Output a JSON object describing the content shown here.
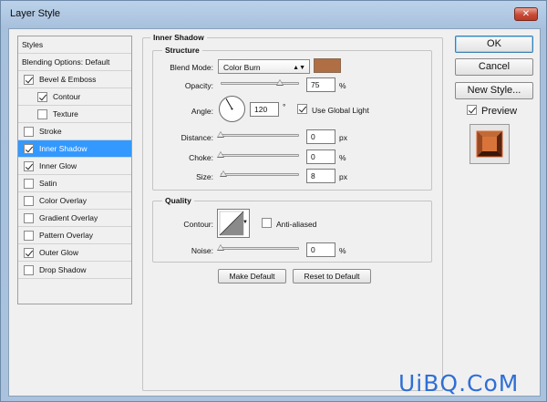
{
  "window": {
    "title": "Layer Style",
    "close_glyph": "✕"
  },
  "left_panel": {
    "header": "Styles",
    "blending": "Blending Options: Default",
    "items": [
      {
        "label": "Bevel & Emboss",
        "checked": true,
        "sub": false,
        "selected": false
      },
      {
        "label": "Contour",
        "checked": true,
        "sub": true,
        "selected": false
      },
      {
        "label": "Texture",
        "checked": false,
        "sub": true,
        "selected": false
      },
      {
        "label": "Stroke",
        "checked": false,
        "sub": false,
        "selected": false
      },
      {
        "label": "Inner Shadow",
        "checked": true,
        "sub": false,
        "selected": true
      },
      {
        "label": "Inner Glow",
        "checked": true,
        "sub": false,
        "selected": false
      },
      {
        "label": "Satin",
        "checked": false,
        "sub": false,
        "selected": false
      },
      {
        "label": "Color Overlay",
        "checked": false,
        "sub": false,
        "selected": false
      },
      {
        "label": "Gradient Overlay",
        "checked": false,
        "sub": false,
        "selected": false
      },
      {
        "label": "Pattern Overlay",
        "checked": false,
        "sub": false,
        "selected": false
      },
      {
        "label": "Outer Glow",
        "checked": true,
        "sub": false,
        "selected": false
      },
      {
        "label": "Drop Shadow",
        "checked": false,
        "sub": false,
        "selected": false
      }
    ]
  },
  "inner_shadow": {
    "title": "Inner Shadow",
    "structure": {
      "title": "Structure",
      "blend_mode_label": "Blend Mode:",
      "blend_mode_value": "Color Burn",
      "blend_mode_arrow": "▲▼",
      "swatch_color": "#b06e45",
      "opacity_label": "Opacity:",
      "opacity_value": "75",
      "opacity_level": 0.75,
      "percent": "%",
      "angle_label": "Angle:",
      "angle_value": "120",
      "degree": "°",
      "use_global_light_label": "Use Global Light",
      "use_global_light_checked": true,
      "distance_label": "Distance:",
      "distance_value": "0",
      "distance_level": 0,
      "px": "px",
      "choke_label": "Choke:",
      "choke_value": "0",
      "choke_level": 0,
      "size_label": "Size:",
      "size_value": "8",
      "size_level": 0.032
    },
    "quality": {
      "title": "Quality",
      "contour_label": "Contour:",
      "anti_aliased_label": "Anti-aliased",
      "anti_aliased_checked": false,
      "noise_label": "Noise:",
      "noise_value": "0",
      "noise_level": 0
    },
    "make_default_label": "Make Default",
    "reset_default_label": "Reset to Default"
  },
  "buttons": {
    "ok_label": "OK",
    "cancel_label": "Cancel",
    "new_style_label": "New Style...",
    "preview_label": "Preview",
    "preview_checked": true
  },
  "watermark": "UiBQ.CoM",
  "colors": {
    "selection": "#3399ff",
    "accent_swatch": "#b06e45",
    "watermark": "#2f6fd6"
  }
}
